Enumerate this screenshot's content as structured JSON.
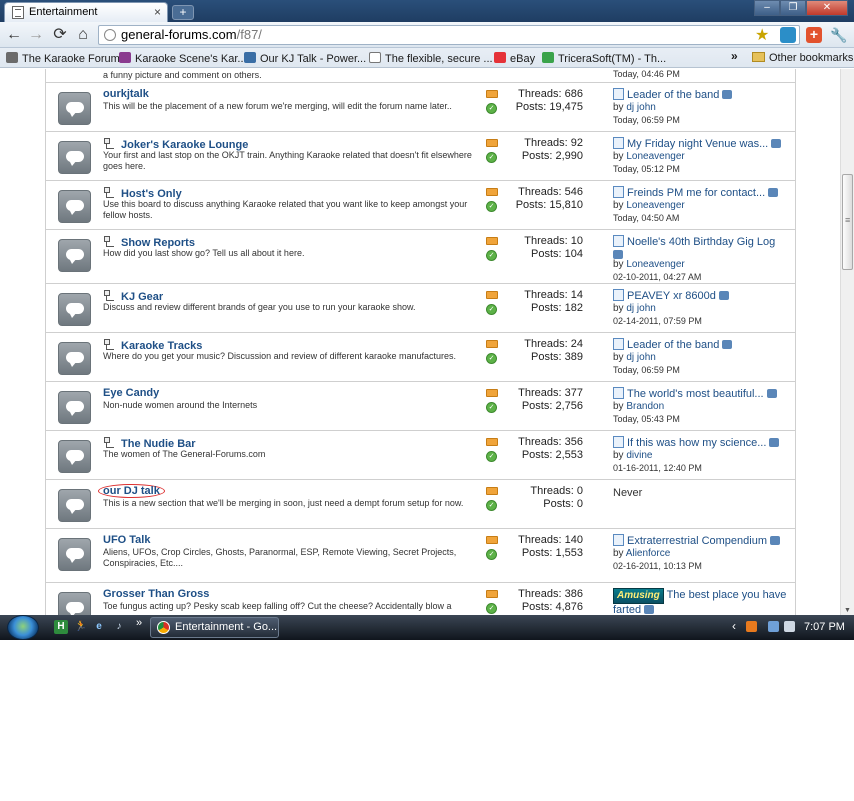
{
  "browser": {
    "tab_title": "Entertainment",
    "tab_close": "×",
    "new_tab": "+",
    "url_host": "general-forums.com",
    "url_path": "/f87/",
    "bookmarks": [
      {
        "label": "The Karaoke Forum",
        "icon": "karaoke-forum-icon",
        "color": "#6b6b6b"
      },
      {
        "label": "Karaoke Scene's Kar...",
        "icon": "karaoke-scene-icon",
        "color": "#8a3b8f"
      },
      {
        "label": "Our KJ Talk - Power...",
        "icon": "kj-talk-icon",
        "color": "#3a6ea5"
      },
      {
        "label": "The flexible, secure ...",
        "icon": "page-icon",
        "color": "#ffffff"
      },
      {
        "label": "eBay",
        "icon": "ebay-icon",
        "color": "#e53238"
      },
      {
        "label": "TriceraSoft(TM) - Th...",
        "icon": "tricerasoft-icon",
        "color": "#3aa34a"
      }
    ],
    "bookmarks_more": "»",
    "other_bookmarks": "Other bookmarks"
  },
  "partial_row": {
    "description": "a funny picture and comment on others.",
    "time": "Today, 04:46 PM"
  },
  "forums": [
    {
      "title": "ourkjtalk",
      "subforums": false,
      "description": "This will be the placement of a new forum we're merging, will edit the forum name later..",
      "threads": "Threads: 686",
      "posts": "Posts: 19,475",
      "last_title": "Leader of the band",
      "last_user": "dj john",
      "last_date": "Today, 06:59 PM"
    },
    {
      "title": "Joker's Karaoke Lounge",
      "subforums": true,
      "description": "Your first and last stop on the OKJT train. Anything Karaoke related that doesn't fit elsewhere goes here.",
      "threads": "Threads: 92",
      "posts": "Posts: 2,990",
      "last_title": "My Friday night Venue was...",
      "last_user": "Loneavenger",
      "last_date": "Today, 05:12 PM"
    },
    {
      "title": "Host's Only",
      "subforums": true,
      "description": "Use this board to discuss anything Karaoke related that you want like to keep amongst your fellow hosts.",
      "threads": "Threads: 546",
      "posts": "Posts: 15,810",
      "last_title": "Freinds PM me for contact...",
      "last_user": "Loneavenger",
      "last_date": "Today, 04:50 AM"
    },
    {
      "title": "Show Reports",
      "subforums": true,
      "description": "How did you last show go? Tell us all about it here.",
      "threads": "Threads: 10",
      "posts": "Posts: 104",
      "last_title": "Noelle's 40th Birthday Gig Log",
      "last_user": "Loneavenger",
      "last_date": "02-10-2011, 04:27 AM"
    },
    {
      "title": "KJ Gear",
      "subforums": true,
      "description": "Discuss and review different brands of gear you use to run your karaoke show.",
      "threads": "Threads: 14",
      "posts": "Posts: 182",
      "last_title": "PEAVEY xr 8600d",
      "last_user": "dj john",
      "last_date": "02-14-2011, 07:59 PM"
    },
    {
      "title": "Karaoke Tracks",
      "subforums": true,
      "description": "Where do you get your music? Discussion and review of different karaoke manufactures.",
      "threads": "Threads: 24",
      "posts": "Posts: 389",
      "last_title": "Leader of the band",
      "last_user": "dj john",
      "last_date": "Today, 06:59 PM"
    },
    {
      "title": "Eye Candy",
      "subforums": false,
      "description": "Non-nude women around the Internets",
      "threads": "Threads: 377",
      "posts": "Posts: 2,756",
      "last_title": "The world's most beautiful...",
      "last_user": "Brandon",
      "last_date": "Today, 05:43 PM"
    },
    {
      "title": "The Nudie Bar",
      "subforums": true,
      "description": "The women of The General-Forums.com",
      "threads": "Threads: 356",
      "posts": "Posts: 2,553",
      "last_title": "If this was how my science...",
      "last_user": "divine",
      "last_date": "01-16-2011, 12:40 PM"
    },
    {
      "title": "our DJ talk",
      "subforums": false,
      "description": "This is a new section that we'll be merging in soon, just need a dempt forum setup for now.",
      "threads": "Threads: 0",
      "posts": "Posts: 0",
      "never": "Never"
    },
    {
      "title": "UFO Talk",
      "subforums": false,
      "description": "Aliens, UFOs, Crop Circles, Ghosts, Paranormal, ESP, Remote Viewing, Secret Projects, Conspiracies, Etc....",
      "threads": "Threads: 140",
      "posts": "Posts: 1,553",
      "last_title": "Extraterrestrial Compendium",
      "last_user": "Alienforce",
      "last_date": "02-16-2011, 10:13 PM"
    },
    {
      "title": "Grosser Than Gross",
      "subforums": false,
      "description": "Toe fungus acting up? Pesky scab keep falling off? Cut the cheese? Accidentally blow a",
      "threads": "Threads: 386",
      "posts": "Posts: 4,876",
      "badge": "Amusing",
      "last_title": "The best place you have",
      "last_title_2": "farted"
    }
  ],
  "by_prefix": "by",
  "taskbar": {
    "task_label": "Entertainment - Go...",
    "chevron": "»",
    "tray_arrow": "‹",
    "time": "7:07 PM"
  }
}
